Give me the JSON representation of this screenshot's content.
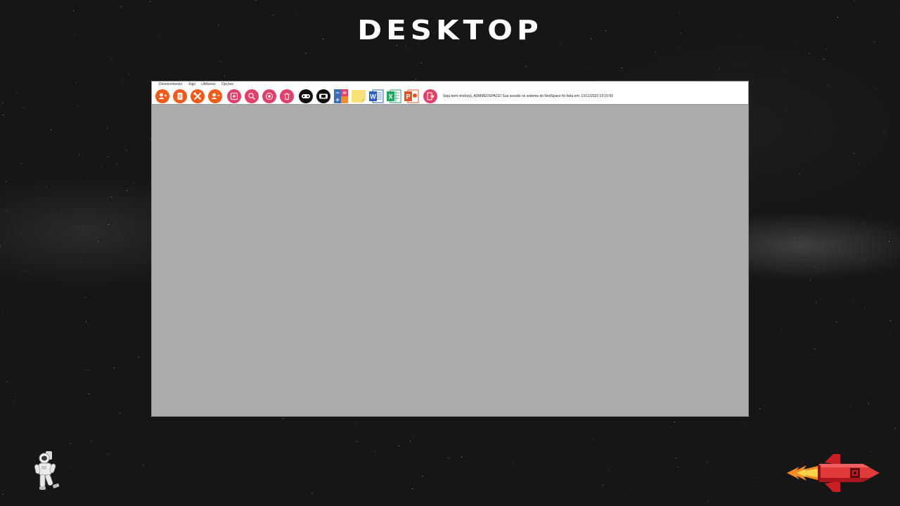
{
  "slide": {
    "title": "DESKTOP",
    "background_color": "#161616"
  },
  "app": {
    "menu": [
      "Desenvolvedor",
      "Jogo",
      "Utilitarios",
      "Opções"
    ],
    "toolbar": [
      {
        "name": "add-user",
        "icon": "user-plus-icon",
        "color": "#f05a1a"
      },
      {
        "name": "report",
        "icon": "document-icon",
        "color": "#f05a1a"
      },
      {
        "name": "tools",
        "icon": "tools-icon",
        "color": "#f05a1a"
      },
      {
        "name": "remove-user",
        "icon": "user-minus-icon",
        "color": "#f05a1a"
      },
      {
        "name": "add-game",
        "icon": "plus-icon",
        "color": "#e0406a"
      },
      {
        "name": "search-game",
        "icon": "search-icon",
        "color": "#e0406a"
      },
      {
        "name": "view-game",
        "icon": "eye-icon",
        "color": "#e0406a"
      },
      {
        "name": "delete-game",
        "icon": "trash-icon",
        "color": "#e0406a"
      },
      {
        "name": "gamepad",
        "icon": "gamepad-icon",
        "color": "#111111"
      },
      {
        "name": "game-console",
        "icon": "console-icon",
        "color": "#111111"
      },
      {
        "name": "calculator",
        "icon": "calculator-icon",
        "color": "#3a6fb8"
      },
      {
        "name": "notepad",
        "icon": "sticky-note-icon",
        "color": "#f7e27a"
      },
      {
        "name": "word",
        "icon": "word-icon",
        "color": "#2b5fb8"
      },
      {
        "name": "excel",
        "icon": "excel-icon",
        "color": "#21a366"
      },
      {
        "name": "powerpoint",
        "icon": "powerpoint-icon",
        "color": "#e0542d"
      },
      {
        "name": "logout",
        "icon": "logout-icon",
        "color": "#e0406a"
      }
    ],
    "welcome_text": "Seja bem-vindo(a), ADMREDSPACE! Sua sessão no sistema do RedSpace foi feita em: 13/11/2023 19:15:50",
    "workspace_color": "#ababab"
  },
  "decorations": {
    "astronaut": "astronaut-icon",
    "rocket": "rocket-icon"
  }
}
